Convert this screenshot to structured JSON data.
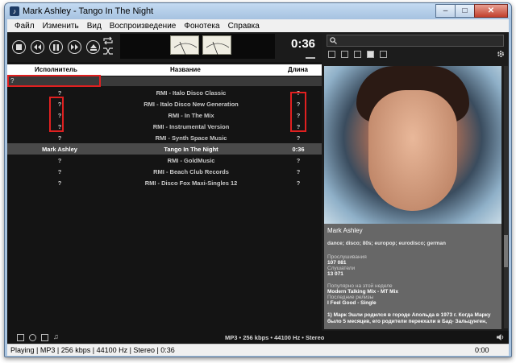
{
  "window": {
    "title": "Mark Ashley - Tango In The Night"
  },
  "window_buttons": {
    "minimize": "–",
    "maximize": "□",
    "close": "✕"
  },
  "menu": [
    "Файл",
    "Изменить",
    "Вид",
    "Воспроизведение",
    "Фонотека",
    "Справка"
  ],
  "player": {
    "time": "0:36"
  },
  "columns": {
    "artist": "Исполнитель",
    "title": "Название",
    "length": "Длина"
  },
  "filter": {
    "value": "?"
  },
  "tracks": [
    {
      "artist": "?",
      "title": "RMI - Italo Disco Classic",
      "length": "?"
    },
    {
      "artist": "?",
      "title": "RMI - Italo Disco New Generation",
      "length": "?"
    },
    {
      "artist": "?",
      "title": "RMI - In The Mix",
      "length": "?"
    },
    {
      "artist": "?",
      "title": "RMI - Instrumental Version",
      "length": "?"
    },
    {
      "artist": "?",
      "title": "RMI - Synth Space Music",
      "length": "?"
    },
    {
      "artist": "Mark Ashley",
      "title": "Tango In The Night",
      "length": "0:36",
      "selected": true
    },
    {
      "artist": "?",
      "title": "RMI - GoldMusic",
      "length": "?"
    },
    {
      "artist": "?",
      "title": "RMI - Beach Club Records",
      "length": "?"
    },
    {
      "artist": "?",
      "title": "RMI - Disco Fox Maxi-Singles 12",
      "length": "?"
    }
  ],
  "format_info": "MP3 • 256 kbps • 44100 Hz • Stereo",
  "artist_info": {
    "name": "Mark Ashley",
    "tags": "dance; disco; 80s; europop; eurodisco; german",
    "plays_label": "Прослушивания",
    "plays_value": "107 081",
    "listeners_label": "Слушатели",
    "listeners_value": "13 071",
    "popular_label": "Популярно на этой неделе",
    "popular_value": "Modern Talking Mix - MT Mix",
    "releases_label": "Последние релизы",
    "releases_value": "I Feel Good - Single",
    "bio": "1) Марк Эшли родился в городе Апольда в 1973 г. Когда Марку было 5 месяцев, его родители переехали в Бад- Зальцунген,"
  },
  "statusbar": {
    "left": "Playing | MP3 | 256 kbps | 44100 Hz | Stereo | 0:36",
    "right": "0:00"
  },
  "colors": {
    "app_bg": "#141414",
    "highlight_box": "#e02020",
    "selected_row": "#4a4a4a"
  }
}
